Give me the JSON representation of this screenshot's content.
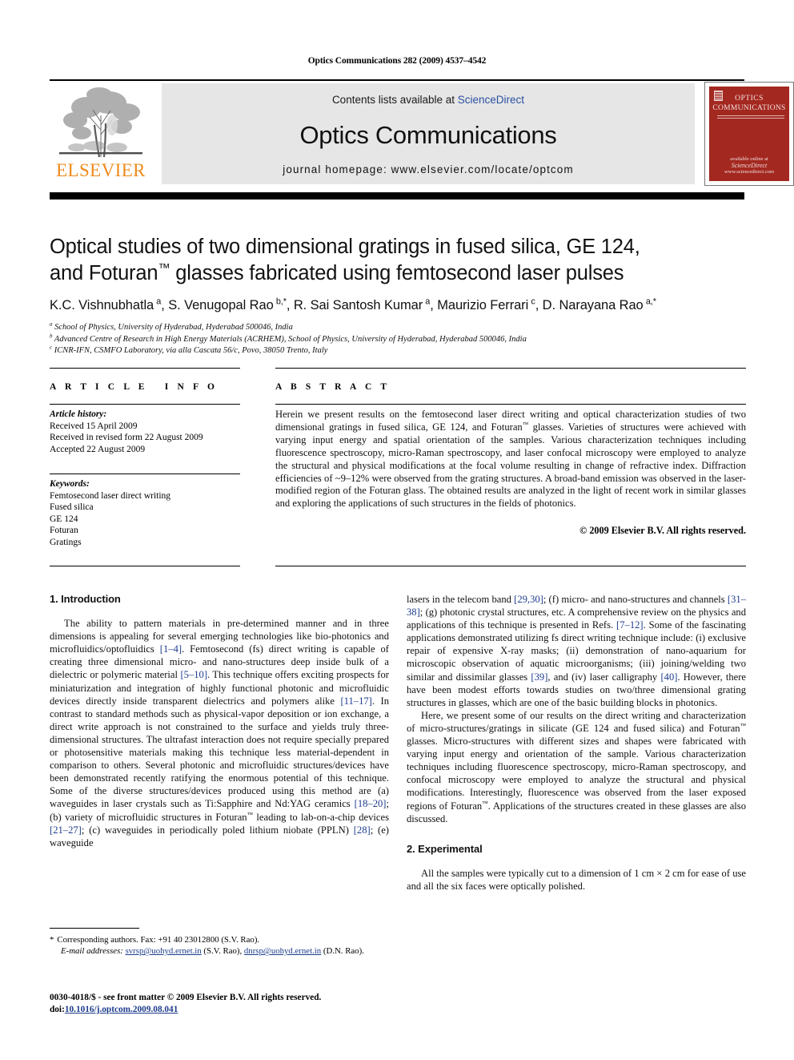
{
  "running_head": "Optics Communications 282 (2009) 4537–4542",
  "masthead": {
    "publisher_name": "ELSEVIER",
    "contents_prefix": "Contents lists available at ",
    "contents_link": "ScienceDirect",
    "journal_title": "Optics Communications",
    "homepage": "journal homepage: www.elsevier.com/locate/optcom",
    "cover": {
      "line1": "OPTICS",
      "line2": "COMMUNICATIONS",
      "footer_top": "available online at",
      "footer_brand": "ScienceDirect",
      "footer_bottom": "www.sciencedirect.com"
    }
  },
  "article": {
    "title_line1": "Optical studies of two dimensional gratings in fused silica, GE 124,",
    "title_line2_a": "and Foturan",
    "title_line2_tm": "™",
    "title_line2_b": " glasses fabricated using femtosecond laser pulses",
    "authors": "K.C. Vishnubhatla a, S. Venugopal Rao b,*, R. Sai Santosh Kumar a, Maurizio Ferrari c, D. Narayana Rao a,*",
    "affiliations": [
      "a School of Physics, University of Hyderabad, Hyderabad 500046, India",
      "b Advanced Centre of Research in High Energy Materials (ACRHEM), School of Physics, University of Hyderabad, Hyderabad 500046, India",
      "c ICNR-IFN, CSMFO Laboratory, via alla Cascata 56/c, Povo, 38050 Trento, Italy"
    ]
  },
  "info": {
    "heading": "ARTICLE INFO",
    "history_label": "Article history:",
    "history": [
      "Received 15 April 2009",
      "Received in revised form 22 August 2009",
      "Accepted 22 August 2009"
    ],
    "keywords_label": "Keywords:",
    "keywords": [
      "Femtosecond laser direct writing",
      "Fused silica",
      "GE 124",
      "Foturan",
      "Gratings"
    ]
  },
  "abstract": {
    "heading": "ABSTRACT",
    "text_part1": "Herein we present results on the femtosecond laser direct writing and optical characterization studies of two dimensional gratings in fused silica, GE 124, and Foturan",
    "text_part2": " glasses. Varieties of structures were achieved with varying input energy and spatial orientation of the samples. Various characterization techniques including fluorescence spectroscopy, micro-Raman spectroscopy, and laser confocal microscopy were employed to analyze the structural and physical modifications at the focal volume resulting in change of refractive index. Diffraction efficiencies of ~9–12% were observed from the grating structures. A broad-band emission was observed in the laser-modified region of the Foturan glass. The obtained results are analyzed in the light of recent work in similar glasses and exploring the applications of such structures in the fields of photonics.",
    "copyright": "© 2009 Elsevier B.V. All rights reserved."
  },
  "body": {
    "section1_heading": "1. Introduction",
    "left_p1_a": "The ability to pattern materials in pre-determined manner and in three dimensions is appealing for several emerging technologies like bio-photonics and microfluidics/optofluidics ",
    "left_p1_r1": "[1–4]",
    "left_p1_b": ". Femtosecond (fs) direct writing is capable of creating three dimensional micro- and nano-structures deep inside bulk of a dielectric or polymeric material ",
    "left_p1_r2": "[5–10]",
    "left_p1_c": ". This technique offers exciting prospects for miniaturization and integration of highly functional photonic and microfluidic devices directly inside transparent dielectrics and polymers alike ",
    "left_p1_r3": "[11–17]",
    "left_p1_d": ". In contrast to standard methods such as physical-vapor deposition or ion exchange, a direct write approach is not constrained to the surface and yields truly three-dimensional structures. The ultrafast interaction does not require specially prepared or photosensitive materials making this technique less material-dependent in comparison to others. Several photonic and microfluidic structures/devices have been demonstrated recently ratifying the enormous potential of this technique. Some of the diverse structures/devices produced using this method are (a) waveguides in laser crystals such as Ti:Sapphire and Nd:YAG ceramics ",
    "left_p1_r4": "[18–20]",
    "left_p1_e": "; (b) variety of microfluidic structures in Foturan",
    "left_p1_f": " leading to lab-on-a-chip devices ",
    "left_p1_r5": "[21–27]",
    "left_p1_g": "; (c) waveguides in periodically poled lithium niobate (PPLN) ",
    "left_p1_r6": "[28]",
    "left_p1_h": "; (e) waveguide",
    "right_p1_a": "lasers in the telecom band ",
    "right_p1_r1": "[29,30]",
    "right_p1_b": "; (f) micro- and nano-structures and channels ",
    "right_p1_r2": "[31–38]",
    "right_p1_c": "; (g) photonic crystal structures, etc. A comprehensive review on the physics and applications of this technique is presented in Refs. ",
    "right_p1_r3": "[7–12]",
    "right_p1_d": ". Some of the fascinating applications demonstrated utilizing fs direct writing technique include: (i) exclusive repair of expensive X-ray masks; (ii) demonstration of nano-aquarium for microscopic observation of aquatic microorganisms; (iii) joining/welding two similar and dissimilar glasses ",
    "right_p1_r4": "[39]",
    "right_p1_e": ", and (iv) laser calligraphy ",
    "right_p1_r5": "[40]",
    "right_p1_f": ". However, there have been modest efforts towards studies on two/three dimensional grating structures in glasses, which are one of the basic building blocks in photonics.",
    "right_p2_a": "Here, we present some of our results on the direct writing and characterization of micro-structures/gratings in silicate (GE 124 and fused silica) and Foturan",
    "right_p2_b": " glasses. Micro-structures with different sizes and shapes were fabricated with varying input energy and orientation of the sample. Various characterization techniques including fluorescence spectroscopy, micro-Raman spectroscopy, and confocal microscopy were employed to analyze the structural and physical modifications. Interestingly, fluorescence was observed from the laser exposed regions of Foturan",
    "right_p2_c": ". Applications of the structures created in these glasses are also discussed.",
    "section2_heading": "2. Experimental",
    "right_p3": "All the samples were typically cut to a dimension of 1 cm × 2 cm for ease of use and all the six faces were optically polished."
  },
  "footnotes": {
    "corresponding": "Corresponding authors. Fax: +91 40 23012800 (S.V. Rao).",
    "email_label": "E-mail addresses:",
    "email1": "svrsp@uohyd.ernet.in",
    "email1_who": " (S.V. Rao), ",
    "email2": "dnrsp@uohyd.ernet.in",
    "email2_who": " (D.N. Rao)."
  },
  "imprint": {
    "issn_line": "0030-4018/$ - see front matter © 2009 Elsevier B.V. All rights reserved.",
    "doi_label": "doi:",
    "doi_value": "10.1016/j.optcom.2009.08.041"
  },
  "colors": {
    "link_blue": "#2b50a3",
    "ref_blue": "#1d3c8c",
    "elsevier_orange": "#ED8B1C",
    "cover_red": "#A32820",
    "band_gray": "#e6e6e6"
  }
}
